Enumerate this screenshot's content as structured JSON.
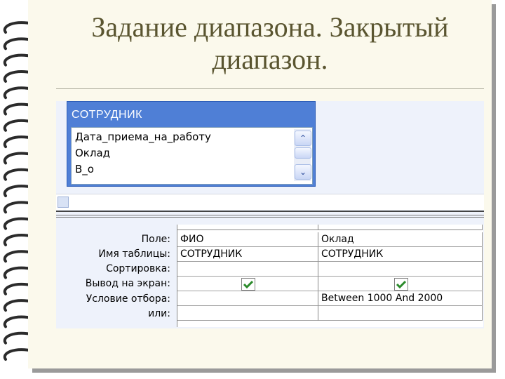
{
  "title": "Задание диапазона. Закрытый диапазон.",
  "table": {
    "name": "СОТРУДНИК",
    "fields": [
      "Дата_приема_на_работу",
      "Оклад",
      "В_о"
    ]
  },
  "grid": {
    "row_labels": [
      "Поле:",
      "Имя таблицы:",
      "Сортировка:",
      "Вывод на экран:",
      "Условие отбора:",
      "или:"
    ],
    "columns": [
      {
        "field": "ФИО",
        "table": "СОТРУДНИК",
        "sort": "",
        "show": true,
        "criteria": "",
        "or": ""
      },
      {
        "field": "Оклад",
        "table": "СОТРУДНИК",
        "sort": "",
        "show": true,
        "criteria": "Between 1000 And 2000",
        "or": ""
      }
    ]
  },
  "colors": {
    "title": "#5a5530",
    "paper": "#fbf9ec",
    "table_header": "#4f7fd6",
    "check": "#2a8a2a"
  }
}
